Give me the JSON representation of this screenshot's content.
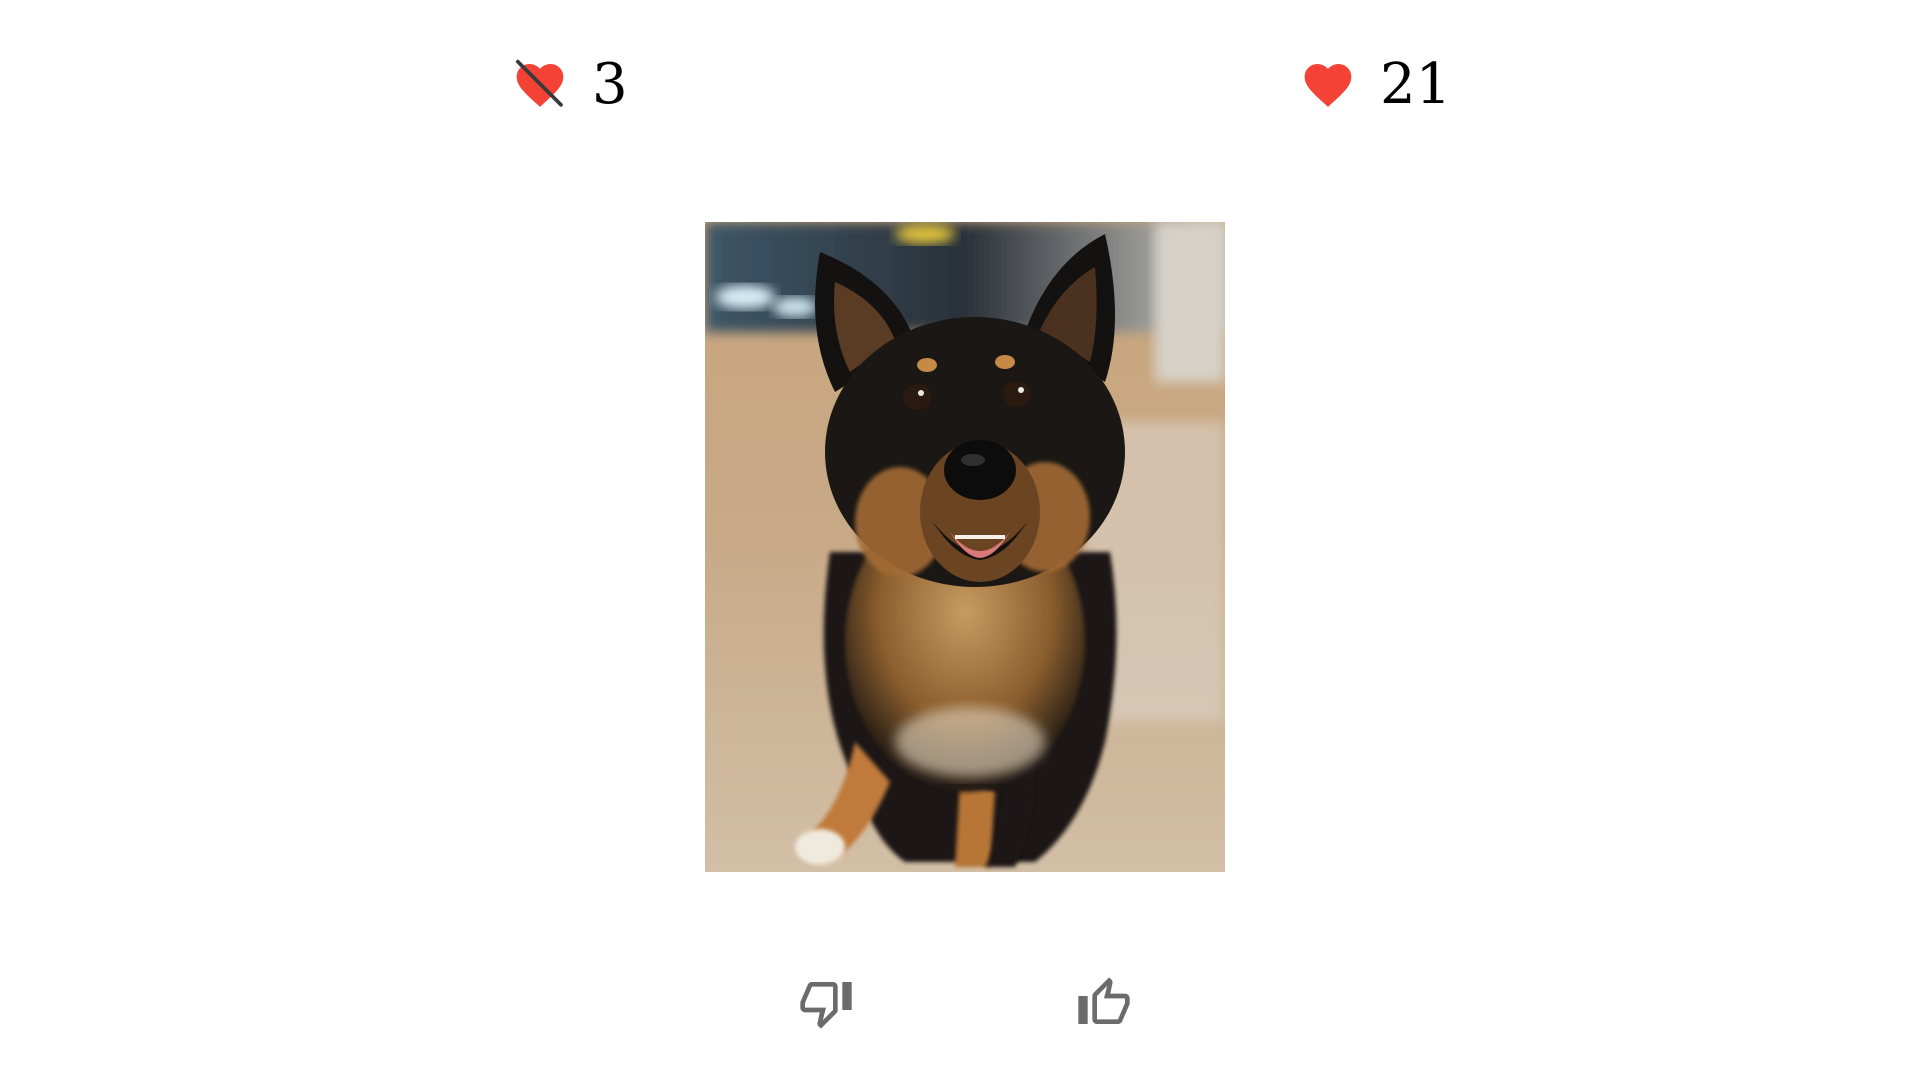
{
  "stats": {
    "dislikes": {
      "icon": "broken-heart-icon",
      "count": "3"
    },
    "likes": {
      "icon": "heart-icon",
      "count": "21"
    }
  },
  "photo": {
    "subject": "dog-photo"
  },
  "actions": {
    "dislike": {
      "icon": "thumbs-down-icon"
    },
    "like": {
      "icon": "thumbs-up-icon"
    }
  },
  "colors": {
    "heart": "#f44336",
    "icon_outline": "#6b6b6b",
    "text": "#000000",
    "background": "#ffffff"
  }
}
